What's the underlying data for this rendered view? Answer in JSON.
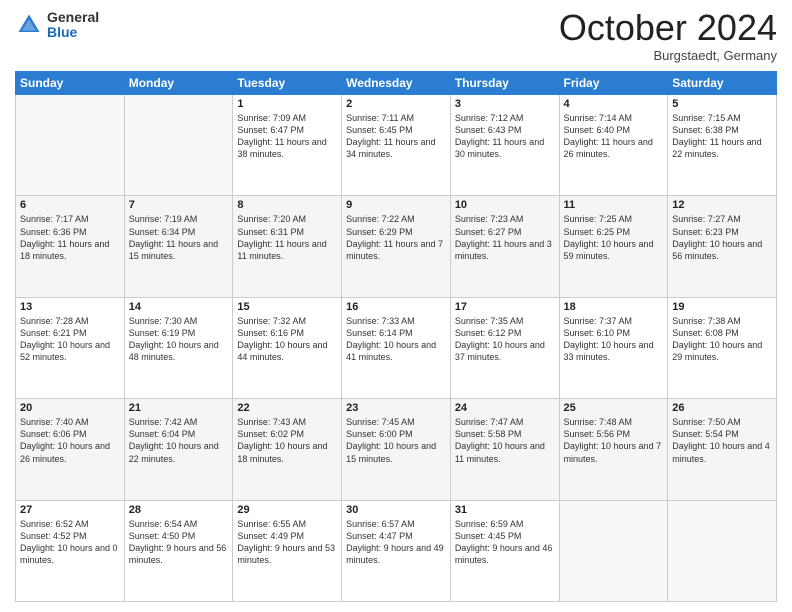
{
  "logo": {
    "general": "General",
    "blue": "Blue"
  },
  "header": {
    "month": "October 2024",
    "location": "Burgstaedt, Germany"
  },
  "weekdays": [
    "Sunday",
    "Monday",
    "Tuesday",
    "Wednesday",
    "Thursday",
    "Friday",
    "Saturday"
  ],
  "weeks": [
    [
      {
        "num": "",
        "info": ""
      },
      {
        "num": "",
        "info": ""
      },
      {
        "num": "1",
        "info": "Sunrise: 7:09 AM\nSunset: 6:47 PM\nDaylight: 11 hours and 38 minutes."
      },
      {
        "num": "2",
        "info": "Sunrise: 7:11 AM\nSunset: 6:45 PM\nDaylight: 11 hours and 34 minutes."
      },
      {
        "num": "3",
        "info": "Sunrise: 7:12 AM\nSunset: 6:43 PM\nDaylight: 11 hours and 30 minutes."
      },
      {
        "num": "4",
        "info": "Sunrise: 7:14 AM\nSunset: 6:40 PM\nDaylight: 11 hours and 26 minutes."
      },
      {
        "num": "5",
        "info": "Sunrise: 7:15 AM\nSunset: 6:38 PM\nDaylight: 11 hours and 22 minutes."
      }
    ],
    [
      {
        "num": "6",
        "info": "Sunrise: 7:17 AM\nSunset: 6:36 PM\nDaylight: 11 hours and 18 minutes."
      },
      {
        "num": "7",
        "info": "Sunrise: 7:19 AM\nSunset: 6:34 PM\nDaylight: 11 hours and 15 minutes."
      },
      {
        "num": "8",
        "info": "Sunrise: 7:20 AM\nSunset: 6:31 PM\nDaylight: 11 hours and 11 minutes."
      },
      {
        "num": "9",
        "info": "Sunrise: 7:22 AM\nSunset: 6:29 PM\nDaylight: 11 hours and 7 minutes."
      },
      {
        "num": "10",
        "info": "Sunrise: 7:23 AM\nSunset: 6:27 PM\nDaylight: 11 hours and 3 minutes."
      },
      {
        "num": "11",
        "info": "Sunrise: 7:25 AM\nSunset: 6:25 PM\nDaylight: 10 hours and 59 minutes."
      },
      {
        "num": "12",
        "info": "Sunrise: 7:27 AM\nSunset: 6:23 PM\nDaylight: 10 hours and 56 minutes."
      }
    ],
    [
      {
        "num": "13",
        "info": "Sunrise: 7:28 AM\nSunset: 6:21 PM\nDaylight: 10 hours and 52 minutes."
      },
      {
        "num": "14",
        "info": "Sunrise: 7:30 AM\nSunset: 6:19 PM\nDaylight: 10 hours and 48 minutes."
      },
      {
        "num": "15",
        "info": "Sunrise: 7:32 AM\nSunset: 6:16 PM\nDaylight: 10 hours and 44 minutes."
      },
      {
        "num": "16",
        "info": "Sunrise: 7:33 AM\nSunset: 6:14 PM\nDaylight: 10 hours and 41 minutes."
      },
      {
        "num": "17",
        "info": "Sunrise: 7:35 AM\nSunset: 6:12 PM\nDaylight: 10 hours and 37 minutes."
      },
      {
        "num": "18",
        "info": "Sunrise: 7:37 AM\nSunset: 6:10 PM\nDaylight: 10 hours and 33 minutes."
      },
      {
        "num": "19",
        "info": "Sunrise: 7:38 AM\nSunset: 6:08 PM\nDaylight: 10 hours and 29 minutes."
      }
    ],
    [
      {
        "num": "20",
        "info": "Sunrise: 7:40 AM\nSunset: 6:06 PM\nDaylight: 10 hours and 26 minutes."
      },
      {
        "num": "21",
        "info": "Sunrise: 7:42 AM\nSunset: 6:04 PM\nDaylight: 10 hours and 22 minutes."
      },
      {
        "num": "22",
        "info": "Sunrise: 7:43 AM\nSunset: 6:02 PM\nDaylight: 10 hours and 18 minutes."
      },
      {
        "num": "23",
        "info": "Sunrise: 7:45 AM\nSunset: 6:00 PM\nDaylight: 10 hours and 15 minutes."
      },
      {
        "num": "24",
        "info": "Sunrise: 7:47 AM\nSunset: 5:58 PM\nDaylight: 10 hours and 11 minutes."
      },
      {
        "num": "25",
        "info": "Sunrise: 7:48 AM\nSunset: 5:56 PM\nDaylight: 10 hours and 7 minutes."
      },
      {
        "num": "26",
        "info": "Sunrise: 7:50 AM\nSunset: 5:54 PM\nDaylight: 10 hours and 4 minutes."
      }
    ],
    [
      {
        "num": "27",
        "info": "Sunrise: 6:52 AM\nSunset: 4:52 PM\nDaylight: 10 hours and 0 minutes."
      },
      {
        "num": "28",
        "info": "Sunrise: 6:54 AM\nSunset: 4:50 PM\nDaylight: 9 hours and 56 minutes."
      },
      {
        "num": "29",
        "info": "Sunrise: 6:55 AM\nSunset: 4:49 PM\nDaylight: 9 hours and 53 minutes."
      },
      {
        "num": "30",
        "info": "Sunrise: 6:57 AM\nSunset: 4:47 PM\nDaylight: 9 hours and 49 minutes."
      },
      {
        "num": "31",
        "info": "Sunrise: 6:59 AM\nSunset: 4:45 PM\nDaylight: 9 hours and 46 minutes."
      },
      {
        "num": "",
        "info": ""
      },
      {
        "num": "",
        "info": ""
      }
    ]
  ]
}
